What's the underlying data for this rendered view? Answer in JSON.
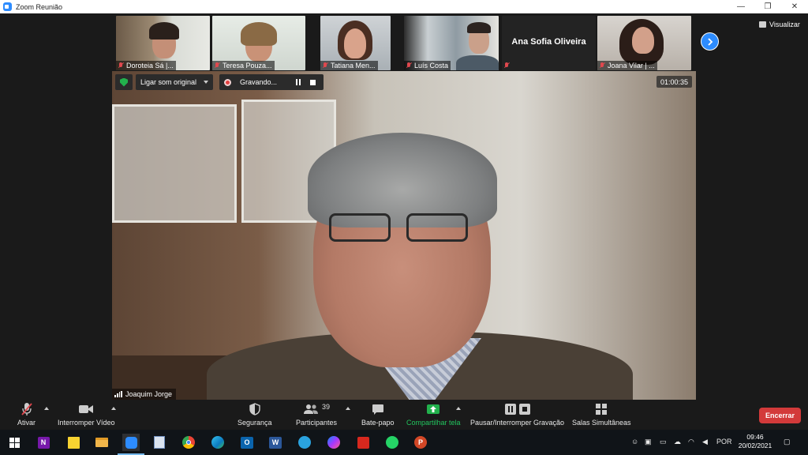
{
  "window": {
    "title": "Zoom Reunião",
    "minimize_glyph": "—",
    "maximize_glyph": "❐",
    "close_glyph": "✕"
  },
  "view_button": {
    "label": "Visualizar"
  },
  "thumbnails": [
    {
      "name": "Doroteia Sá |..."
    },
    {
      "name": "Teresa Pouza..."
    },
    {
      "name": "Tatiana Men..."
    },
    {
      "name": "Luís Costa"
    },
    {
      "name": "",
      "big_name": "Ana Sofia Oliveira"
    },
    {
      "name": "Joana Vilar | ..."
    }
  ],
  "video": {
    "original_sound_label": "Ligar som original",
    "recording_label": "Gravando...",
    "timer": "01:00:35",
    "speaker_name": "Joaquim Jorge"
  },
  "toolbar": {
    "unmute": "Ativar",
    "stop_video": "Interromper Vídeo",
    "security": "Segurança",
    "participants": "Participantes",
    "participants_count": "39",
    "chat": "Bate-papo",
    "share": "Compartilhar tela",
    "pause_recording": "Pausar/Interromper Gravação",
    "breakout": "Salas Simultâneas",
    "end": "Encerrar",
    "share_color": "#22b14c",
    "end_color": "#d33a3a"
  },
  "taskbar": {
    "language": "POR",
    "time": "09:46",
    "date": "20/02/2021"
  },
  "colors": {
    "zoom_blue": "#2d8cff",
    "muted_red": "#e0484e"
  }
}
